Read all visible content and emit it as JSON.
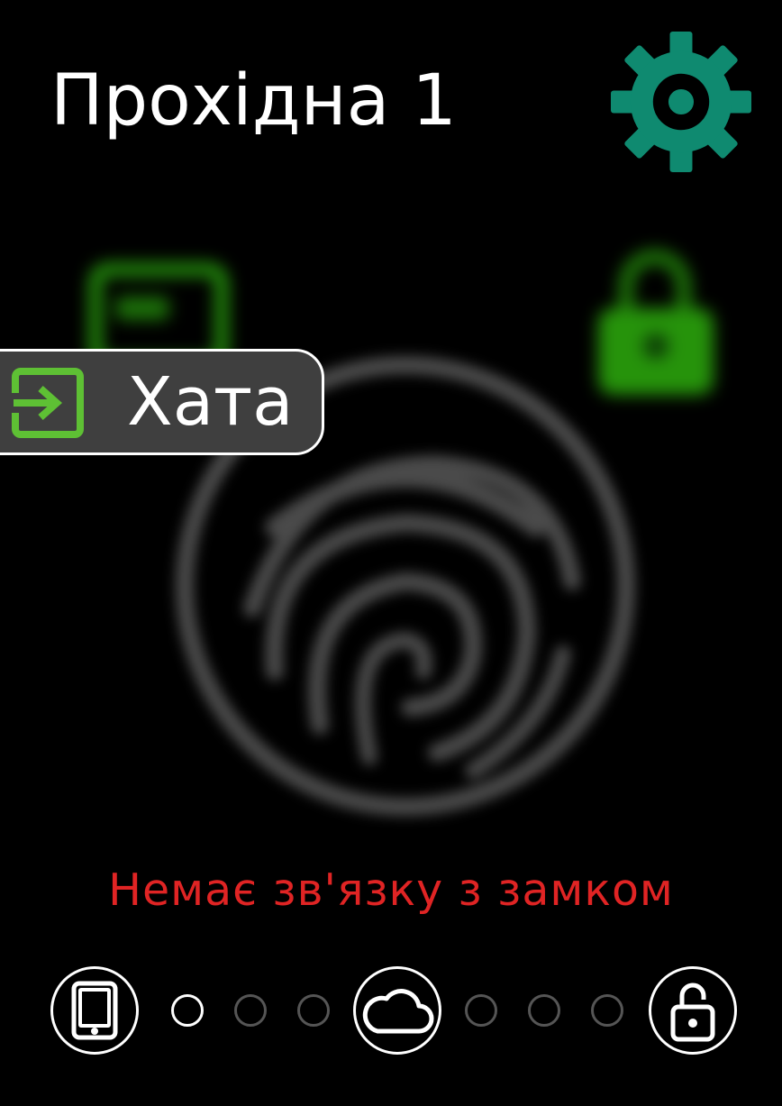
{
  "header": {
    "title": "Прохідна 1",
    "settings_icon": "gear-icon",
    "settings_color": "#0f8a70"
  },
  "background": {
    "fingerprint_icon": "fingerprint-icon",
    "sim_icon": "sim-card-icon",
    "lock_icon": "padlock-icon",
    "accent_green": "#33cc11"
  },
  "selected_place": {
    "label": "Хата",
    "icon": "enter-icon",
    "icon_color": "#5ec034"
  },
  "status": {
    "message": "Немає зв'язку з замком",
    "color": "#e02424"
  },
  "connection_bar": {
    "left_device": "tablet-icon",
    "middle_device": "cloud-icon",
    "right_device": "unlock-icon",
    "left_dots": [
      "active",
      "inactive",
      "inactive"
    ],
    "right_dots": [
      "inactive",
      "inactive",
      "inactive"
    ]
  }
}
